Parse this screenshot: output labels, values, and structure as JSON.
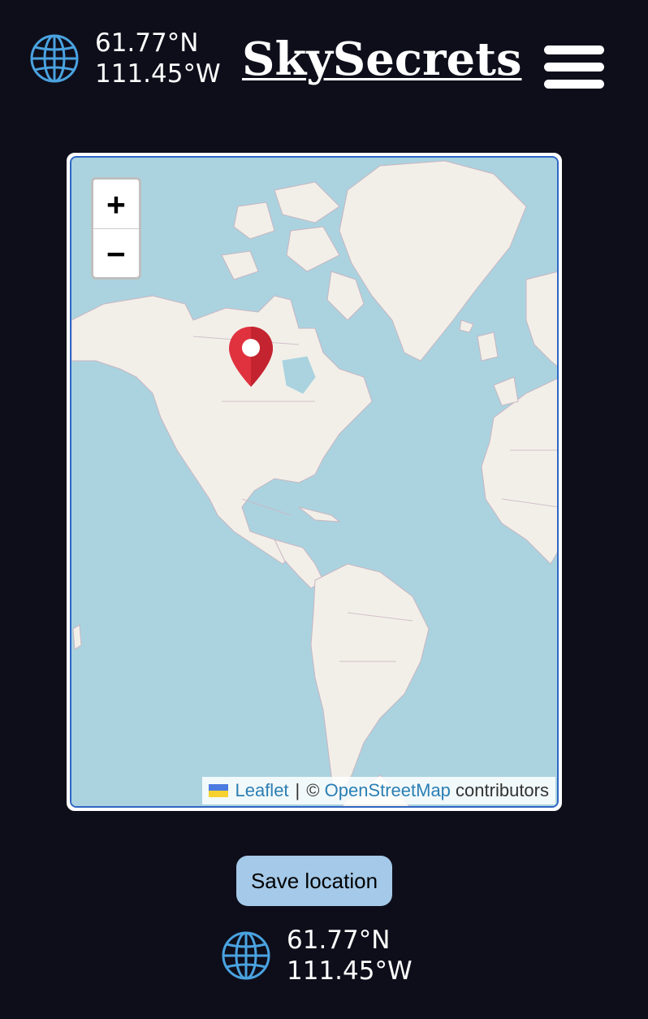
{
  "header": {
    "brand": "SkySecrets",
    "coords": {
      "lat": "61.77°N",
      "lon": "111.45°W"
    },
    "globe_icon": "globe-icon",
    "menu_icon": "hamburger-menu-icon"
  },
  "map": {
    "zoom_in_label": "+",
    "zoom_out_label": "−",
    "marker_icon": "map-pin-icon",
    "attribution": {
      "leaflet": "Leaflet",
      "separator": "|",
      "copyright": "©",
      "osm": "OpenStreetMap",
      "contributors": "contributors"
    },
    "colors": {
      "water": "#aad3df",
      "land": "#f2efe9",
      "border": "#2f66c4",
      "marker": "#e0323e"
    }
  },
  "actions": {
    "save_label": "Save location"
  },
  "footer": {
    "coords": {
      "lat": "61.77°N",
      "lon": "111.45°W"
    }
  }
}
